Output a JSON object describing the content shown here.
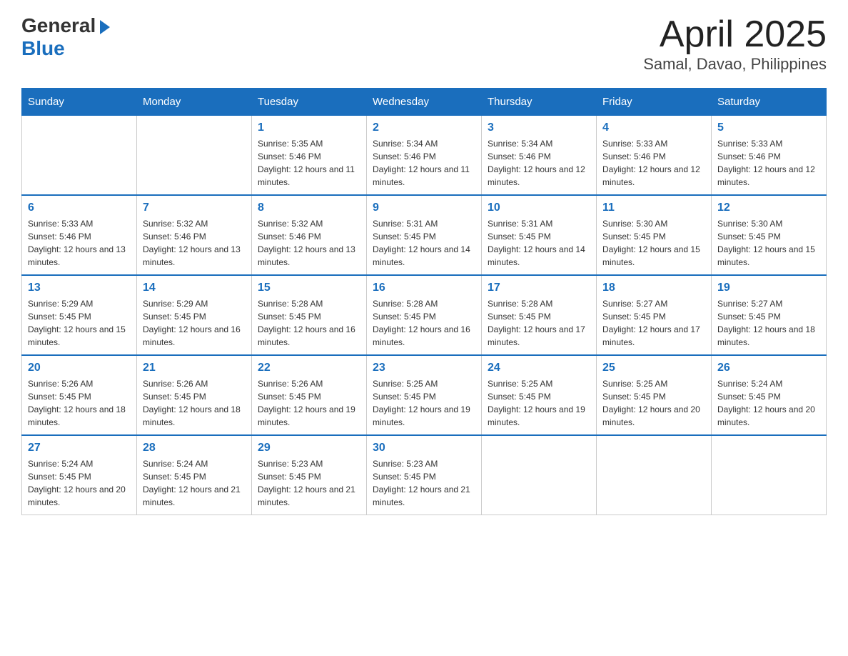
{
  "header": {
    "logo_general": "General",
    "logo_blue": "Blue",
    "month_title": "April 2025",
    "location": "Samal, Davao, Philippines"
  },
  "weekdays": [
    "Sunday",
    "Monday",
    "Tuesday",
    "Wednesday",
    "Thursday",
    "Friday",
    "Saturday"
  ],
  "weeks": [
    [
      {
        "day": "",
        "sunrise": "",
        "sunset": "",
        "daylight": ""
      },
      {
        "day": "",
        "sunrise": "",
        "sunset": "",
        "daylight": ""
      },
      {
        "day": "1",
        "sunrise": "Sunrise: 5:35 AM",
        "sunset": "Sunset: 5:46 PM",
        "daylight": "Daylight: 12 hours and 11 minutes."
      },
      {
        "day": "2",
        "sunrise": "Sunrise: 5:34 AM",
        "sunset": "Sunset: 5:46 PM",
        "daylight": "Daylight: 12 hours and 11 minutes."
      },
      {
        "day": "3",
        "sunrise": "Sunrise: 5:34 AM",
        "sunset": "Sunset: 5:46 PM",
        "daylight": "Daylight: 12 hours and 12 minutes."
      },
      {
        "day": "4",
        "sunrise": "Sunrise: 5:33 AM",
        "sunset": "Sunset: 5:46 PM",
        "daylight": "Daylight: 12 hours and 12 minutes."
      },
      {
        "day": "5",
        "sunrise": "Sunrise: 5:33 AM",
        "sunset": "Sunset: 5:46 PM",
        "daylight": "Daylight: 12 hours and 12 minutes."
      }
    ],
    [
      {
        "day": "6",
        "sunrise": "Sunrise: 5:33 AM",
        "sunset": "Sunset: 5:46 PM",
        "daylight": "Daylight: 12 hours and 13 minutes."
      },
      {
        "day": "7",
        "sunrise": "Sunrise: 5:32 AM",
        "sunset": "Sunset: 5:46 PM",
        "daylight": "Daylight: 12 hours and 13 minutes."
      },
      {
        "day": "8",
        "sunrise": "Sunrise: 5:32 AM",
        "sunset": "Sunset: 5:46 PM",
        "daylight": "Daylight: 12 hours and 13 minutes."
      },
      {
        "day": "9",
        "sunrise": "Sunrise: 5:31 AM",
        "sunset": "Sunset: 5:45 PM",
        "daylight": "Daylight: 12 hours and 14 minutes."
      },
      {
        "day": "10",
        "sunrise": "Sunrise: 5:31 AM",
        "sunset": "Sunset: 5:45 PM",
        "daylight": "Daylight: 12 hours and 14 minutes."
      },
      {
        "day": "11",
        "sunrise": "Sunrise: 5:30 AM",
        "sunset": "Sunset: 5:45 PM",
        "daylight": "Daylight: 12 hours and 15 minutes."
      },
      {
        "day": "12",
        "sunrise": "Sunrise: 5:30 AM",
        "sunset": "Sunset: 5:45 PM",
        "daylight": "Daylight: 12 hours and 15 minutes."
      }
    ],
    [
      {
        "day": "13",
        "sunrise": "Sunrise: 5:29 AM",
        "sunset": "Sunset: 5:45 PM",
        "daylight": "Daylight: 12 hours and 15 minutes."
      },
      {
        "day": "14",
        "sunrise": "Sunrise: 5:29 AM",
        "sunset": "Sunset: 5:45 PM",
        "daylight": "Daylight: 12 hours and 16 minutes."
      },
      {
        "day": "15",
        "sunrise": "Sunrise: 5:28 AM",
        "sunset": "Sunset: 5:45 PM",
        "daylight": "Daylight: 12 hours and 16 minutes."
      },
      {
        "day": "16",
        "sunrise": "Sunrise: 5:28 AM",
        "sunset": "Sunset: 5:45 PM",
        "daylight": "Daylight: 12 hours and 16 minutes."
      },
      {
        "day": "17",
        "sunrise": "Sunrise: 5:28 AM",
        "sunset": "Sunset: 5:45 PM",
        "daylight": "Daylight: 12 hours and 17 minutes."
      },
      {
        "day": "18",
        "sunrise": "Sunrise: 5:27 AM",
        "sunset": "Sunset: 5:45 PM",
        "daylight": "Daylight: 12 hours and 17 minutes."
      },
      {
        "day": "19",
        "sunrise": "Sunrise: 5:27 AM",
        "sunset": "Sunset: 5:45 PM",
        "daylight": "Daylight: 12 hours and 18 minutes."
      }
    ],
    [
      {
        "day": "20",
        "sunrise": "Sunrise: 5:26 AM",
        "sunset": "Sunset: 5:45 PM",
        "daylight": "Daylight: 12 hours and 18 minutes."
      },
      {
        "day": "21",
        "sunrise": "Sunrise: 5:26 AM",
        "sunset": "Sunset: 5:45 PM",
        "daylight": "Daylight: 12 hours and 18 minutes."
      },
      {
        "day": "22",
        "sunrise": "Sunrise: 5:26 AM",
        "sunset": "Sunset: 5:45 PM",
        "daylight": "Daylight: 12 hours and 19 minutes."
      },
      {
        "day": "23",
        "sunrise": "Sunrise: 5:25 AM",
        "sunset": "Sunset: 5:45 PM",
        "daylight": "Daylight: 12 hours and 19 minutes."
      },
      {
        "day": "24",
        "sunrise": "Sunrise: 5:25 AM",
        "sunset": "Sunset: 5:45 PM",
        "daylight": "Daylight: 12 hours and 19 minutes."
      },
      {
        "day": "25",
        "sunrise": "Sunrise: 5:25 AM",
        "sunset": "Sunset: 5:45 PM",
        "daylight": "Daylight: 12 hours and 20 minutes."
      },
      {
        "day": "26",
        "sunrise": "Sunrise: 5:24 AM",
        "sunset": "Sunset: 5:45 PM",
        "daylight": "Daylight: 12 hours and 20 minutes."
      }
    ],
    [
      {
        "day": "27",
        "sunrise": "Sunrise: 5:24 AM",
        "sunset": "Sunset: 5:45 PM",
        "daylight": "Daylight: 12 hours and 20 minutes."
      },
      {
        "day": "28",
        "sunrise": "Sunrise: 5:24 AM",
        "sunset": "Sunset: 5:45 PM",
        "daylight": "Daylight: 12 hours and 21 minutes."
      },
      {
        "day": "29",
        "sunrise": "Sunrise: 5:23 AM",
        "sunset": "Sunset: 5:45 PM",
        "daylight": "Daylight: 12 hours and 21 minutes."
      },
      {
        "day": "30",
        "sunrise": "Sunrise: 5:23 AM",
        "sunset": "Sunset: 5:45 PM",
        "daylight": "Daylight: 12 hours and 21 minutes."
      },
      {
        "day": "",
        "sunrise": "",
        "sunset": "",
        "daylight": ""
      },
      {
        "day": "",
        "sunrise": "",
        "sunset": "",
        "daylight": ""
      },
      {
        "day": "",
        "sunrise": "",
        "sunset": "",
        "daylight": ""
      }
    ]
  ]
}
